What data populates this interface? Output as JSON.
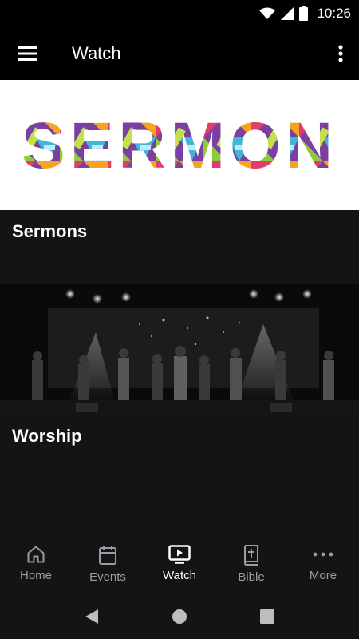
{
  "status_bar": {
    "time": "10:26"
  },
  "app_bar": {
    "title": "Watch"
  },
  "cards": [
    {
      "label": "Sermons",
      "banner_text": "SERMON"
    },
    {
      "label": "Worship"
    }
  ],
  "bottom_nav": {
    "items": [
      {
        "label": "Home",
        "icon": "home-icon",
        "active": false
      },
      {
        "label": "Events",
        "icon": "calendar-icon",
        "active": false
      },
      {
        "label": "Watch",
        "icon": "video-play-icon",
        "active": true
      },
      {
        "label": "Bible",
        "icon": "bible-icon",
        "active": false
      },
      {
        "label": "More",
        "icon": "more-dots-icon",
        "active": false
      }
    ]
  },
  "colors": {
    "background": "#141416",
    "bar": "#000000",
    "active_nav": "#ffffff",
    "inactive_nav": "#9c9ca0"
  }
}
